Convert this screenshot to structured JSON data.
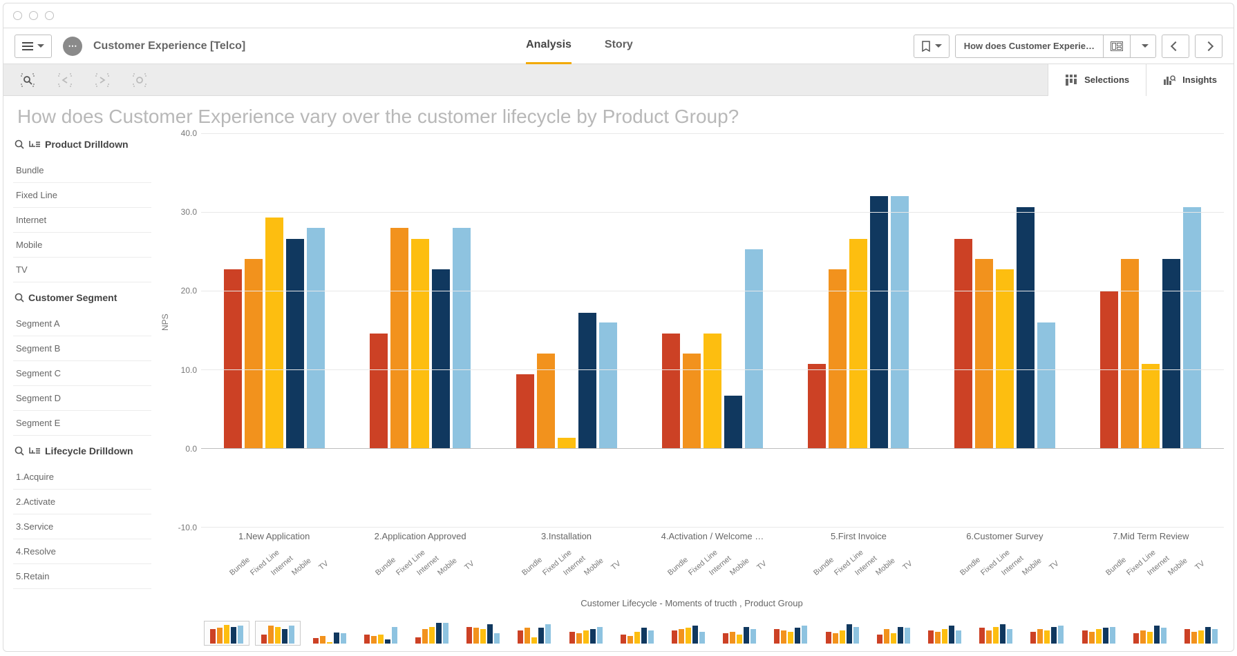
{
  "app": {
    "title": "Customer Experience [Telco]",
    "avatar_glyph": "⋯"
  },
  "tabs": {
    "analysis": "Analysis",
    "story": "Story"
  },
  "sheet_dd": {
    "label": "How does Customer Experie…"
  },
  "selbar": {
    "selections": "Selections",
    "insights": "Insights"
  },
  "page": {
    "title": "How does Customer Experience vary over the customer lifecycle by Product Group?"
  },
  "sidebar": {
    "panels": [
      {
        "id": "product",
        "name": "Product Drilldown",
        "search_icon": true,
        "drill_icon": true,
        "items": [
          "Bundle",
          "Fixed Line",
          "Internet",
          "Mobile",
          "TV"
        ]
      },
      {
        "id": "segment",
        "name": "Customer Segment",
        "search_icon": true,
        "drill_icon": false,
        "items": [
          "Segment A",
          "Segment B",
          "Segment C",
          "Segment D",
          "Segment E"
        ]
      },
      {
        "id": "lifecycle",
        "name": "Lifecycle Drilldown",
        "search_icon": true,
        "drill_icon": true,
        "items": [
          "1.Acquire",
          "2.Activate",
          "3.Service",
          "4.Resolve",
          "5.Retain"
        ]
      }
    ]
  },
  "chart_data": {
    "type": "bar",
    "title": "",
    "ylabel": "NPS",
    "xlabel": "Customer Lifecycle - Moments of tructh ,  Product Group",
    "ylim": [
      -10,
      40
    ],
    "y_ticks": [
      -10.0,
      0.0,
      10.0,
      20.0,
      30.0,
      40.0
    ],
    "sub_categories": [
      "Bundle",
      "Fixed Line",
      "Internet",
      "Mobile",
      "TV"
    ],
    "colors": {
      "Bundle": "#CC4125",
      "Fixed Line": "#F2921D",
      "Internet": "#FDBE10",
      "Mobile": "#10385F",
      "TV": "#8EC3E0"
    },
    "categories": [
      "1.New Application",
      "2.Application Approved",
      "3.Installation",
      "4.Activation / Welcome …",
      "5.First Invoice",
      "6.Customer Survey",
      "7.Mid Term Review"
    ],
    "series": [
      {
        "name": "Bundle",
        "values": [
          22.7,
          14.6,
          9.4,
          14.6,
          10.7,
          26.6,
          20.0
        ]
      },
      {
        "name": "Fixed Line",
        "values": [
          24.0,
          28.0,
          12.0,
          12.0,
          22.7,
          24.0,
          24.0
        ]
      },
      {
        "name": "Internet",
        "values": [
          29.3,
          26.6,
          1.3,
          14.6,
          26.6,
          22.7,
          10.7
        ]
      },
      {
        "name": "Mobile",
        "values": [
          26.6,
          22.7,
          17.2,
          6.7,
          32.0,
          30.6,
          24.0
        ]
      },
      {
        "name": "TV",
        "values": [
          28.0,
          28.0,
          16.0,
          25.3,
          32.0,
          16.0,
          30.6
        ]
      }
    ],
    "mini": {
      "framed_count": 2,
      "groups": [
        [
          22,
          24,
          29,
          26,
          28
        ],
        [
          14,
          28,
          26,
          22,
          28
        ],
        [
          9,
          12,
          1,
          17,
          16
        ],
        [
          14,
          12,
          14,
          6,
          25
        ],
        [
          10,
          22,
          26,
          32,
          32
        ],
        [
          26,
          24,
          22,
          30,
          16
        ],
        [
          20,
          24,
          10,
          24,
          30
        ],
        [
          18,
          16,
          20,
          22,
          26
        ],
        [
          14,
          12,
          18,
          24,
          20
        ],
        [
          20,
          22,
          24,
          28,
          18
        ],
        [
          16,
          18,
          14,
          26,
          22
        ],
        [
          22,
          20,
          18,
          24,
          28
        ],
        [
          18,
          16,
          20,
          30,
          26
        ],
        [
          14,
          22,
          16,
          26,
          24
        ],
        [
          20,
          18,
          22,
          28,
          20
        ],
        [
          24,
          20,
          26,
          30,
          22
        ],
        [
          18,
          22,
          20,
          26,
          28
        ],
        [
          20,
          18,
          22,
          24,
          26
        ],
        [
          16,
          20,
          18,
          28,
          24
        ],
        [
          22,
          18,
          20,
          26,
          22
        ]
      ]
    }
  }
}
